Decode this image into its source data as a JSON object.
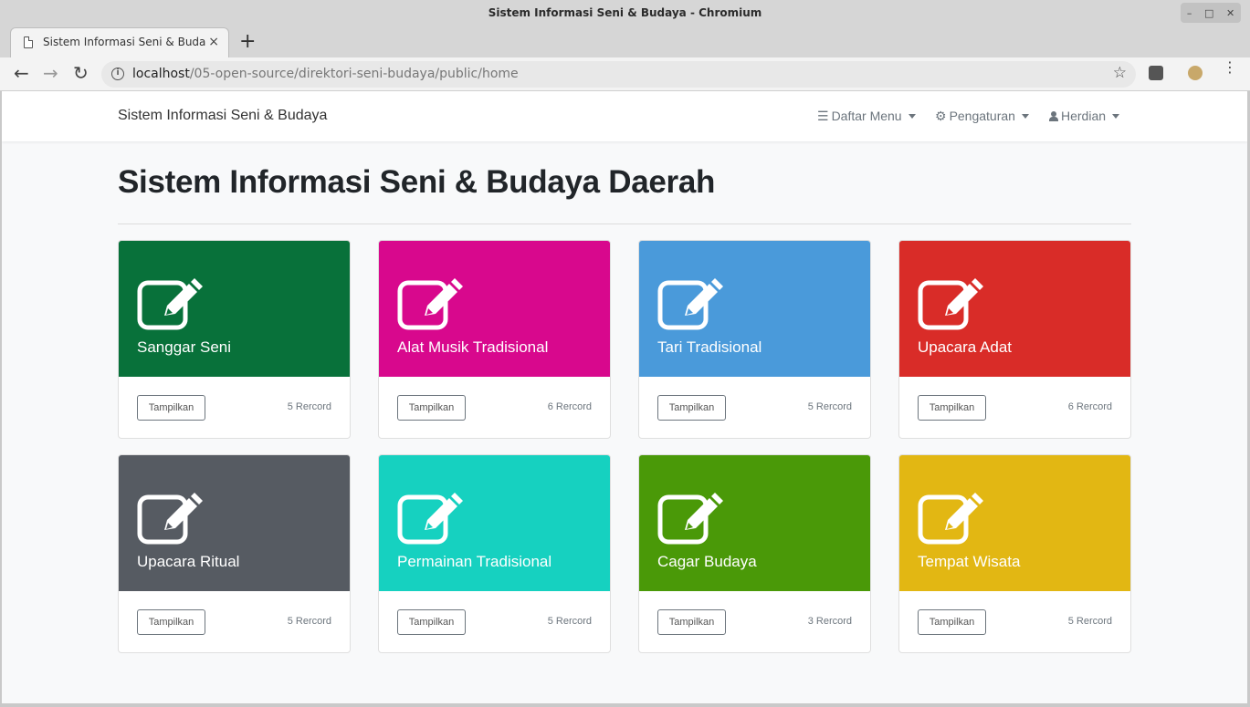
{
  "window": {
    "title": "Sistem Informasi Seni & Budaya - Chromium"
  },
  "tab": {
    "title": "Sistem Informasi Seni & Budaya",
    "close_symbol": "×",
    "new_symbol": "+"
  },
  "address_bar": {
    "host": "localhost",
    "path": "/05-open-source/direktori-seni-budaya/public/home"
  },
  "navbar": {
    "brand": "Sistem Informasi Seni & Budaya",
    "menus": [
      {
        "label": "Daftar Menu",
        "icon": "bars-icon"
      },
      {
        "label": "Pengaturan",
        "icon": "cogs-icon"
      },
      {
        "label": "Herdian",
        "icon": "user-icon"
      }
    ]
  },
  "page": {
    "heading": "Sistem Informasi Seni & Budaya Daerah"
  },
  "cards": [
    {
      "title": "Sanggar Seni",
      "button": "Tampilkan",
      "count": "5 Rercord",
      "color": "#08713a"
    },
    {
      "title": "Alat Musik Tradisional",
      "button": "Tampilkan",
      "count": "6 Rercord",
      "color": "#d8088d"
    },
    {
      "title": "Tari Tradisional",
      "button": "Tampilkan",
      "count": "5 Rercord",
      "color": "#4a9ada"
    },
    {
      "title": "Upacara Adat",
      "button": "Tampilkan",
      "count": "6 Rercord",
      "color": "#d92c28"
    },
    {
      "title": "Upacara Ritual",
      "button": "Tampilkan",
      "count": "5 Rercord",
      "color": "#565b62"
    },
    {
      "title": "Permainan Tradisional",
      "button": "Tampilkan",
      "count": "5 Rercord",
      "color": "#16d1c0"
    },
    {
      "title": "Cagar Budaya",
      "button": "Tampilkan",
      "count": "3 Rercord",
      "color": "#4a9908"
    },
    {
      "title": "Tempat Wisata",
      "button": "Tampilkan",
      "count": "5 Rercord",
      "color": "#e2b713"
    }
  ]
}
